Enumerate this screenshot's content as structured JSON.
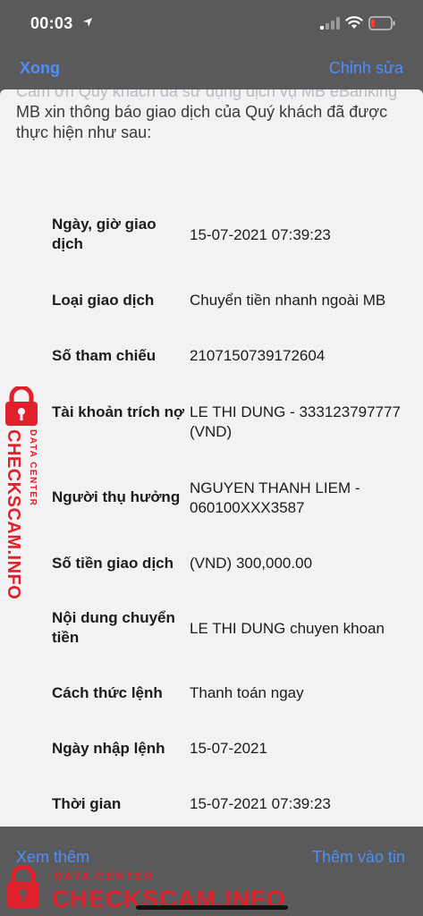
{
  "status_bar": {
    "time": "00:03",
    "icons": [
      "location-arrow-icon",
      "signal-icon",
      "wifi-icon",
      "battery-low-icon"
    ],
    "battery_color": "#ff3b30"
  },
  "nav": {
    "done_label": "Xong",
    "edit_label": "Chỉnh sửa"
  },
  "message": {
    "cut_line": "Cảm ơn Quý khách đã sử dụng dịch vụ MB eBanking",
    "intro": "MB xin thông báo giao dịch của Quý khách đã được thực hiện như sau:"
  },
  "rows": [
    {
      "label": "Ngày, giờ giao dịch",
      "value": "15-07-2021 07:39:23"
    },
    {
      "label": "Loại giao dịch",
      "value": "Chuyển tiền nhanh ngoài MB"
    },
    {
      "label": "Số tham chiếu",
      "value": "2107150739172604"
    },
    {
      "label": "Tài khoản trích nợ",
      "value": "LE THI DUNG - 333123797777 (VND)"
    },
    {
      "label": "Người thụ hưởng",
      "value": "NGUYEN THANH LIEM - 060100XXX3587"
    },
    {
      "label": "Số tiền giao dịch",
      "value": "(VND) 300,000.00"
    },
    {
      "label": "Nội dung chuyển tiền",
      "value": "LE THI DUNG chuyen khoan"
    },
    {
      "label": "Cách thức lệnh",
      "value": "Thanh toán ngay"
    },
    {
      "label": "Ngày nhập lệnh",
      "value": "15-07-2021"
    },
    {
      "label": "Thời gian",
      "value": "15-07-2021 07:39:23"
    }
  ],
  "bottom": {
    "more_label": "Xem thêm",
    "add_label": "Thêm vào tin"
  },
  "watermark": {
    "small": "DATA CENTER",
    "big": "CHECKSCAM.INFO",
    "color": "#e0202a"
  }
}
